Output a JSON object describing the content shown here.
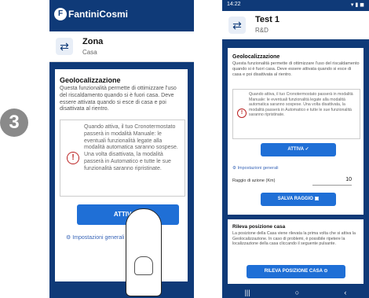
{
  "step_number": "3",
  "left_phone": {
    "logo": "FantiniCosmi",
    "zone": {
      "title": "Zona",
      "subtitle": "Casa"
    },
    "card": {
      "heading": "Geolocalizzazione",
      "intro": "Questa funzionalità permette di ottimizzare l'uso del riscaldamento quando si è fuori casa. Deve essere attivata quando si esce di casa e poi disattivata al rientro.",
      "note": "Quando attiva, il tuo Cronotermostato passerà in modalità Manuale: le eventuali funzionalità legate alla modalità automatica saranno sospese. Una volta disattivata, la modalità passerà in Automatico e tutte le sue funzionalità saranno ripristinate.",
      "button": "ATTIVA",
      "link": "Impostazioni generali"
    }
  },
  "right_phone": {
    "status_time": "14:22",
    "header": {
      "title": "Test 1",
      "subtitle": "R&D"
    },
    "card": {
      "heading": "Geolocalizzazione",
      "intro": "Questa funzionalità permette di ottimizzare l'uso del riscaldamento quando si è fuori casa. Deve essere attivata quando si esce di casa e poi disattivata al rientro.",
      "note": "Quando attiva, il tuo Cronotermostato passerà in modalità Manuale: le eventuali funzionalità legate alla modalità automatica saranno sospese. Una volta disattivata, la modalità passerà in Automatico e tutte le sue funzionalità saranno ripristinate.",
      "button": "ATTIVA",
      "link": "Impostazioni generali",
      "radius_label": "Raggio di azione (Km)",
      "radius_value": "10",
      "save_button": "SALVA RAGGIO",
      "section2_heading": "Rileva posizione casa",
      "section2_text": "La posizione della Casa viene rilevata la prima volta che si attiva la Geolocalizzazione. In caso di problemi, è possibile ripetere la localizzazione della casa cliccando il seguente pulsante.",
      "detect_button": "RILEVA POSIZIONE CASA"
    }
  }
}
